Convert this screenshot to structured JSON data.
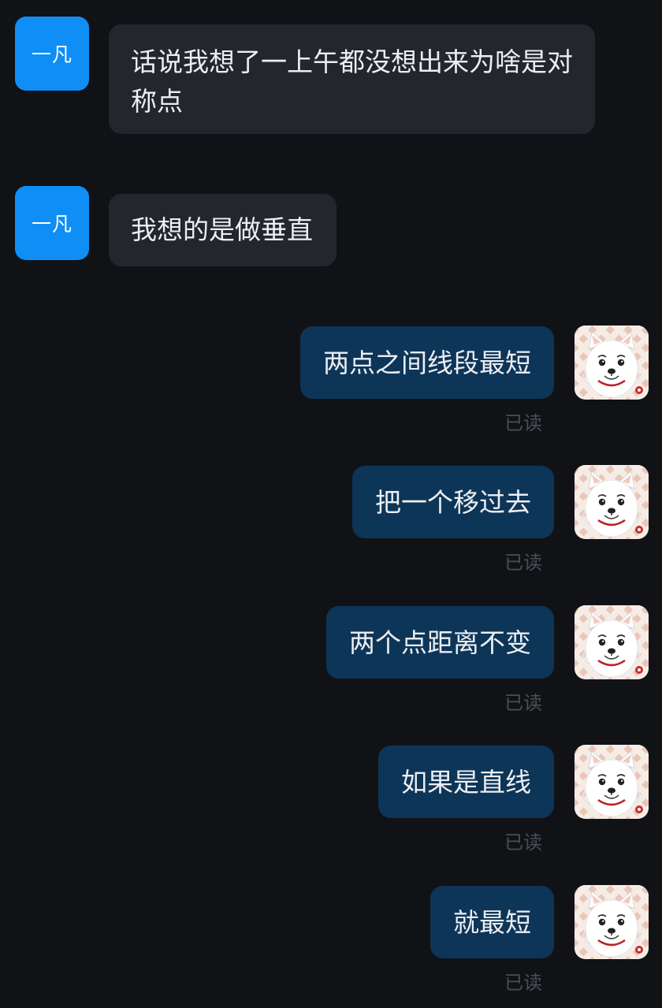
{
  "contact": {
    "avatar_text": "一凡"
  },
  "messages": [
    {
      "from": "contact",
      "text": "话说我想了一上午都没想出来为啥是对称点"
    },
    {
      "from": "contact",
      "text": "我想的是做垂直"
    },
    {
      "from": "me",
      "text": "两点之间线段最短",
      "status": "已读"
    },
    {
      "from": "me",
      "text": "把一个移过去",
      "status": "已读"
    },
    {
      "from": "me",
      "text": "两个点距离不变",
      "status": "已读"
    },
    {
      "from": "me",
      "text": "如果是直线",
      "status": "已读"
    },
    {
      "from": "me",
      "text": "就最短",
      "status": "已读"
    }
  ],
  "colors": {
    "background": "#111216",
    "incoming_bubble": "#24262d",
    "outgoing_bubble": "#0d3558",
    "contact_avatar": "#0f8ef5",
    "read_receipt": "#4a4d55"
  },
  "icons": {
    "my_avatar": "white-dog-avatar-icon"
  }
}
